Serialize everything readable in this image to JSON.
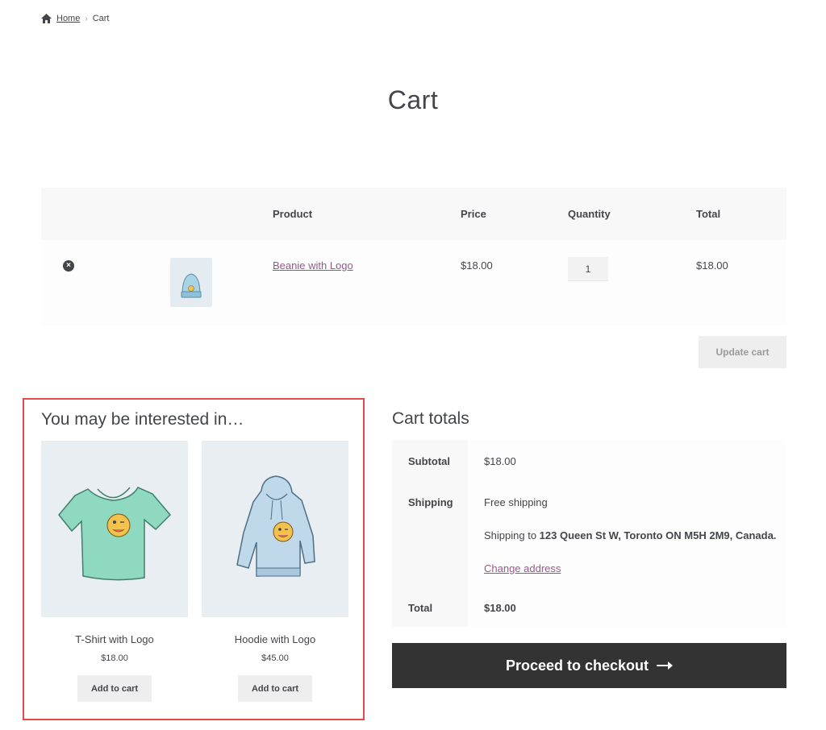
{
  "breadcrumb": {
    "home": "Home",
    "separator": "›",
    "current": "Cart"
  },
  "page_title": "Cart",
  "cart_table": {
    "headers": {
      "product": "Product",
      "price": "Price",
      "quantity": "Quantity",
      "total": "Total"
    },
    "rows": [
      {
        "remove_icon": "×",
        "name": "Beanie with Logo",
        "price": "$18.00",
        "quantity": "1",
        "total": "$18.00"
      }
    ]
  },
  "update_cart_label": "Update cart",
  "cross_sells": {
    "title": "You may be interested in…",
    "items": [
      {
        "name": "T-Shirt with Logo",
        "price": "$18.00",
        "button": "Add to cart"
      },
      {
        "name": "Hoodie with Logo",
        "price": "$45.00",
        "button": "Add to cart"
      }
    ]
  },
  "cart_totals": {
    "title": "Cart totals",
    "subtotal_label": "Subtotal",
    "subtotal_value": "$18.00",
    "shipping_label": "Shipping",
    "shipping_method": "Free shipping",
    "shipping_to_prefix": "Shipping to ",
    "shipping_address": "123 Queen St W, Toronto ON  M5H 2M9, Canada.",
    "change_address": "Change address",
    "total_label": "Total",
    "total_value": "$18.00"
  },
  "checkout_label": "Proceed to checkout",
  "colors": {
    "accent_link": "#96588a",
    "checkout_bg": "#333333",
    "highlight_border": "#e34b4b"
  }
}
